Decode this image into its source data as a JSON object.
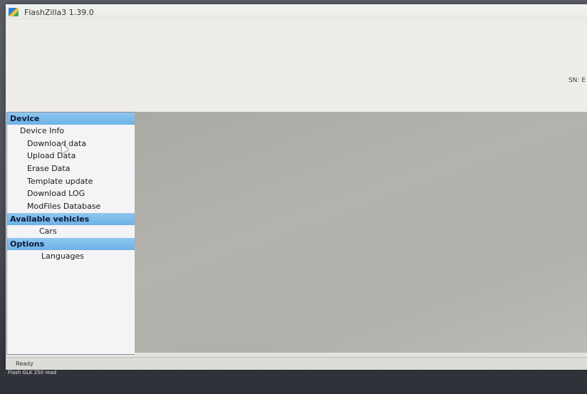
{
  "window": {
    "title": "FlashZilla3 1.39.0"
  },
  "header": {
    "sn_label": "SN: E"
  },
  "sidebar": {
    "groups": [
      {
        "label": "Device",
        "items": [
          "Device Info",
          "Download data",
          "Upload Data",
          "Erase Data",
          "Template update",
          "Download LOG",
          "ModFiles Database"
        ]
      },
      {
        "label": "Available vehicles",
        "items": [
          "Cars"
        ]
      },
      {
        "label": "Options",
        "items": [
          "Languages"
        ]
      }
    ]
  },
  "status": {
    "text": "Ready"
  },
  "desktop": {
    "icon_label": "Flash GLK 250 read"
  },
  "colors": {
    "group_header": "#7bbcec",
    "content_bg": "#b1b0ab",
    "sidebar_bg": "#f4f4f6"
  }
}
